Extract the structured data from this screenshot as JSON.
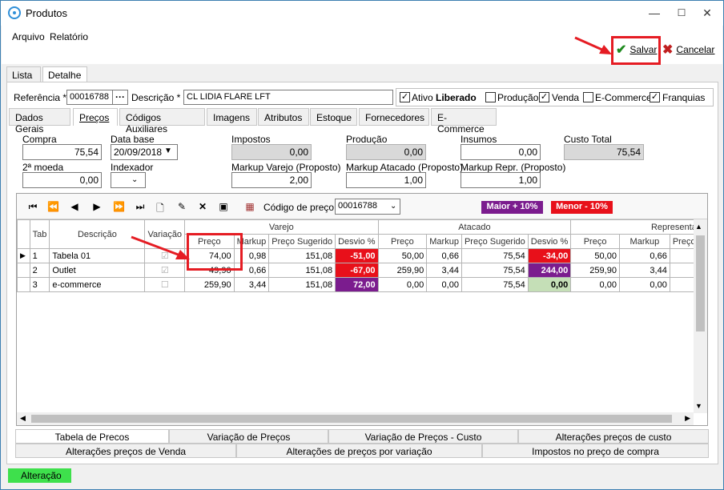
{
  "window": {
    "title": "Produtos",
    "minimize": "—",
    "maximize": "☐",
    "close": "✕"
  },
  "menu": {
    "arquivo": "Arquivo",
    "relatorio": "Relatório"
  },
  "toolbar": {
    "save_label": "Salvar",
    "cancel_label": "Cancelar"
  },
  "top_tabs": [
    "Lista",
    "Detalhe"
  ],
  "header": {
    "referencia_label": "Referência *",
    "referencia_value": "00016788",
    "ellipsis": "···",
    "descricao_label": "Descrição *",
    "descricao_value": "CL LIDIA FLARE LFT",
    "ativo": "Ativo",
    "liberado": "Liberado",
    "producao": "Produção",
    "venda": "Venda",
    "ecommerce": "E-Commerce",
    "franquias": "Franquias"
  },
  "sub_tabs": [
    "Dados Gerais",
    "Preços",
    "Códigos Auxiliares",
    "Imagens",
    "Atributos",
    "Estoque",
    "Fornecedores",
    "E-Commerce"
  ],
  "prices": {
    "compra_label": "Compra",
    "compra": "75,54",
    "database_label": "Data base",
    "database": "20/09/2018",
    "impostos_label": "Impostos",
    "impostos": "0,00",
    "producao_label": "Produção",
    "producao": "0,00",
    "insumos_label": "Insumos",
    "insumos": "0,00",
    "custo_label": "Custo Total",
    "custo": "75,54",
    "moeda_label": "2ª moeda",
    "moeda": "0,00",
    "indexador_label": "Indexador",
    "mk_varejo_label": "Markup Varejo (Proposto)",
    "mk_varejo": "2,00",
    "mk_atacado_label": "Markup Atacado (Proposto)",
    "mk_atacado": "1,00",
    "mk_repr_label": "Markup Repr. (Proposto)",
    "mk_repr": "1,00"
  },
  "grid_toolbar": {
    "codigo_label": "Código de preço",
    "codigo_value": "00016788",
    "maior": "Maior + 10%",
    "menor": "Menor - 10%"
  },
  "grid": {
    "groups": {
      "varejo": "Varejo",
      "atacado": "Atacado",
      "repr": "Representant"
    },
    "cols": {
      "tab": "Tab",
      "desc": "Descrição",
      "variacao": "Variação",
      "preco": "Preço",
      "markup": "Markup",
      "sugerido": "Preço Sugerido",
      "desvio": "Desvio %",
      "preco_s": "Preço S"
    },
    "rows": [
      {
        "tab": "1",
        "desc": "Tabela 01",
        "v_preco": "74,00",
        "v_mk": "0,98",
        "v_sug": "151,08",
        "v_desv": "-51,00",
        "a_preco": "50,00",
        "a_mk": "0,66",
        "a_sug": "75,54",
        "a_desv": "-34,00",
        "r_preco": "50,00",
        "r_mk": "0,66"
      },
      {
        "tab": "2",
        "desc": "Outlet",
        "v_preco": "49,90",
        "v_mk": "0,66",
        "v_sug": "151,08",
        "v_desv": "-67,00",
        "a_preco": "259,90",
        "a_mk": "3,44",
        "a_sug": "75,54",
        "a_desv": "244,00",
        "r_preco": "259,90",
        "r_mk": "3,44"
      },
      {
        "tab": "3",
        "desc": "e-commerce",
        "v_preco": "259,90",
        "v_mk": "3,44",
        "v_sug": "151,08",
        "v_desv": "72,00",
        "a_preco": "0,00",
        "a_mk": "0,00",
        "a_sug": "75,54",
        "a_desv": "0,00",
        "r_preco": "0,00",
        "r_mk": "0,00"
      }
    ]
  },
  "bottom_tabs": {
    "row1": [
      "Tabela de Precos",
      "Variação de Preços",
      "Variação de Preços - Custo",
      "Alterações preços de custo"
    ],
    "row2": [
      "Alterações preços de Venda",
      "Alterações de preços por variação",
      "Impostos no preço de compra"
    ]
  },
  "status": "Alteração",
  "colors": {
    "accent": "#e51c23",
    "purple": "#7b1c8e",
    "status_green": "#3ee04c"
  }
}
